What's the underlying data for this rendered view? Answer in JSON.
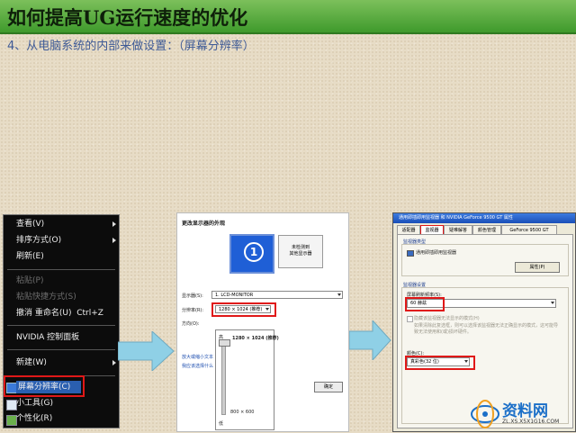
{
  "slide": {
    "title": "如何提高UG运行速度的优化",
    "subtitle": "4、从电脑系统的内部来做设置：（屏幕分辨率）"
  },
  "context_menu": {
    "items": [
      {
        "label": "查看(V)",
        "submenu": true,
        "disabled": false
      },
      {
        "label": "排序方式(O)",
        "submenu": true,
        "disabled": false
      },
      {
        "label": "刷新(E)",
        "submenu": false,
        "disabled": false
      },
      {
        "label": "粘贴(P)",
        "submenu": false,
        "disabled": true
      },
      {
        "label": "粘贴快捷方式(S)",
        "submenu": false,
        "disabled": true
      },
      {
        "label": "撤消 重命名(U)",
        "shortcut": "Ctrl+Z",
        "submenu": false,
        "disabled": false
      },
      {
        "label": "NVIDIA 控制面板",
        "submenu": false,
        "disabled": false
      },
      {
        "label": "新建(W)",
        "submenu": true,
        "disabled": false
      },
      {
        "label": "屏幕分辨率(C)",
        "submenu": false,
        "disabled": false,
        "highlighted": true
      },
      {
        "label": "小工具(G)",
        "submenu": false,
        "disabled": false
      },
      {
        "label": "个性化(R)",
        "submenu": false,
        "disabled": false
      }
    ]
  },
  "display_panel": {
    "heading": "更改显示器的外观",
    "monitor_number": "1",
    "secondary_monitor": "未检测到\n其他显示器",
    "display_label": "显示器(S):",
    "display_value": "1. LCD-MONITOR",
    "resolution_label": "分辨率(R):",
    "resolution_value": "1280 × 1024 (推荐)",
    "orientation_label": "方向(O):",
    "dropdown": {
      "high": "高",
      "max_value": "1280 × 1024 (推荐)",
      "min_value": "800 × 600",
      "low": "低"
    },
    "link_1": "放大或缩小文本",
    "link_2": "我应该选择什么",
    "ok_button": "确定"
  },
  "props_dialog": {
    "title": "通用即插即用监视器 和 NVIDIA GeForce 9500 GT 属性",
    "tabs": [
      "适配器",
      "监视器",
      "疑难解答",
      "颜色管理",
      "GeForce 9500 GT"
    ],
    "active_tab": "监视器",
    "monitor_type_label": "监视器类型",
    "monitor_type_value": "通用即插即用监视器",
    "properties_button": "属性(P)",
    "monitor_settings_label": "监视器设置",
    "refresh_label": "屏幕刷新频率(S):",
    "refresh_value": "60 赫兹",
    "hide_modes_label": "隐藏该监视器无法显示的模式(H)",
    "warning_text": "如果清除此复选框，则可以选择该监视器无法正确显示的模式，这可能导致无法使用和(或)损坏硬件。",
    "colors_label": "颜色(C):",
    "colors_value": "真彩色(32 位)"
  },
  "watermark": {
    "text": "资料网",
    "url": "ZL.XS.X5X1G16.COM"
  },
  "colors": {
    "header_green": "#4aa336",
    "highlight_red": "#e01818",
    "arrow_blue": "#8fd0e6",
    "selection_blue": "#2a5fb0"
  }
}
